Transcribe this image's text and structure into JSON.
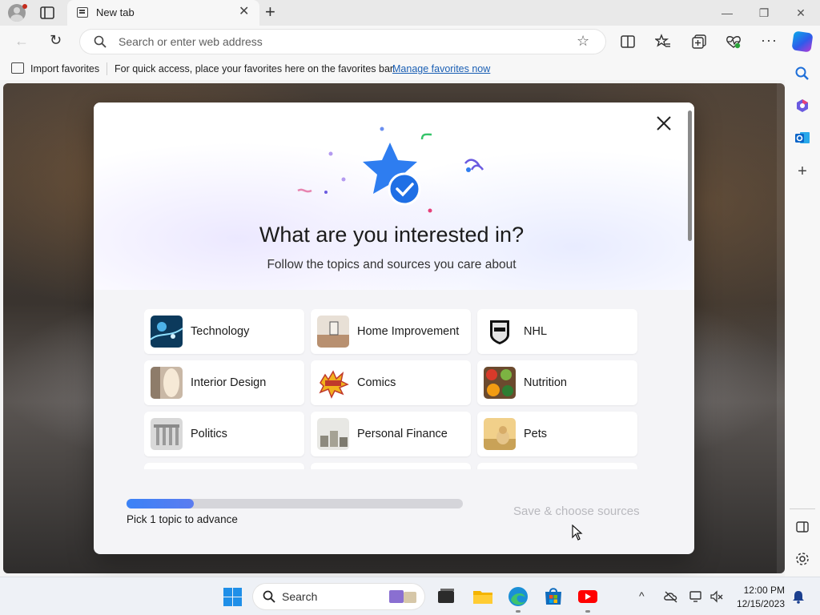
{
  "browser": {
    "tab_title": "New tab",
    "address_placeholder": "Search or enter web address",
    "favorites_bar": {
      "import_label": "Import favorites",
      "message": "For quick access, place your favorites here on the favorites bar.",
      "manage_link": "Manage favorites now"
    }
  },
  "modal": {
    "title": "What are you interested in?",
    "subtitle": "Follow the topics and sources you care about",
    "topics": [
      {
        "label": "Technology",
        "icon": "technology-thumb"
      },
      {
        "label": "Home Improvement",
        "icon": "home-improvement-thumb"
      },
      {
        "label": "NHL",
        "icon": "nhl-logo"
      },
      {
        "label": "Interior Design",
        "icon": "interior-design-thumb"
      },
      {
        "label": "Comics",
        "icon": "comics-thumb"
      },
      {
        "label": "Nutrition",
        "icon": "nutrition-thumb"
      },
      {
        "label": "Politics",
        "icon": "politics-thumb"
      },
      {
        "label": "Personal Finance",
        "icon": "personal-finance-thumb"
      },
      {
        "label": "Pets",
        "icon": "pets-thumb"
      }
    ],
    "progress": {
      "fraction": 0.2,
      "label": "Pick 1 topic to advance"
    },
    "save_label": "Save & choose sources"
  },
  "taskbar": {
    "search_label": "Search",
    "time": "12:00 PM",
    "date": "12/15/2023"
  },
  "colors": {
    "accent": "#1a5fb4",
    "progress_fill": "#3b82f6",
    "youtube": "#ff0000"
  }
}
